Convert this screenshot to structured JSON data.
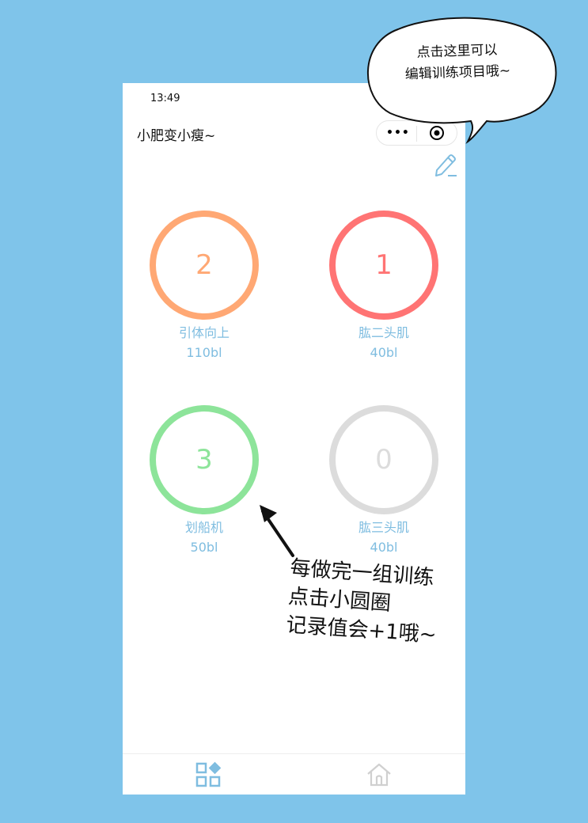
{
  "status_bar": {
    "time": "13:49"
  },
  "app": {
    "title": "小肥变小瘦~"
  },
  "capsule": {
    "more_icon": "more-dots-icon",
    "close_icon": "target-circle-icon"
  },
  "edit": {
    "icon": "pencil-icon"
  },
  "exercises": [
    {
      "count": "2",
      "name": "引体向上",
      "weight": "110bl",
      "color": "#ffa874"
    },
    {
      "count": "1",
      "name": "肱二头肌",
      "weight": "40bl",
      "color": "#ff7474"
    },
    {
      "count": "3",
      "name": "划船机",
      "weight": "50bl",
      "color": "#8de49a"
    },
    {
      "count": "0",
      "name": "肱三头肌",
      "weight": "40bl",
      "color": "#dcdcdc"
    }
  ],
  "tabbar": {
    "tabs": [
      {
        "icon": "grid-apps-icon",
        "color": "#7fbde0",
        "active": true
      },
      {
        "icon": "home-icon",
        "color": "#d0d0d0",
        "active": false
      }
    ]
  },
  "annotations": {
    "bubble_lines": [
      "点击这里可以",
      "编辑训练项目哦~"
    ],
    "note_lines": [
      "每做完一组训练",
      "点击小圆圈",
      "记录值会+1哦~"
    ]
  }
}
